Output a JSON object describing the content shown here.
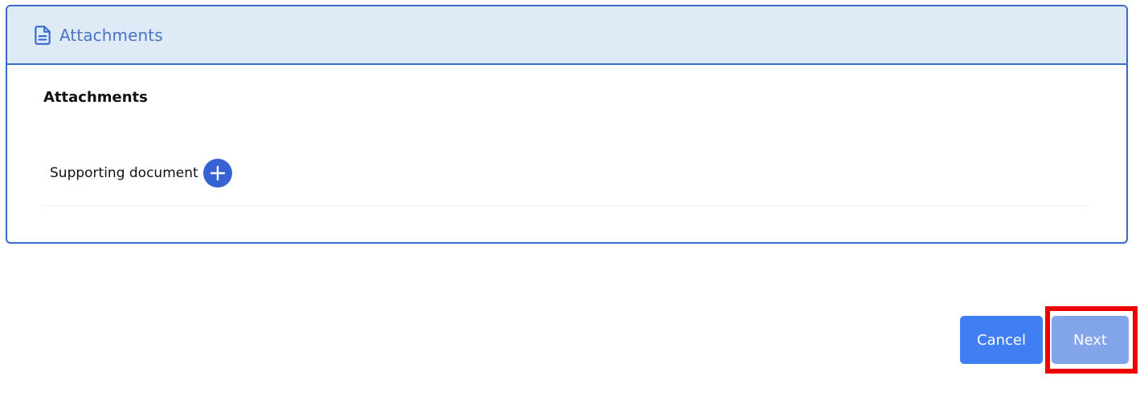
{
  "panel": {
    "header_title": "Attachments",
    "header_icon": "document-icon",
    "section_title": "Attachments",
    "fields": [
      {
        "label": "Supporting document",
        "action_icon": "plus-icon"
      }
    ]
  },
  "footer": {
    "cancel_label": "Cancel",
    "next_label": "Next"
  },
  "colors": {
    "header_bg": "#dfeaf7",
    "border": "#3a6bc9",
    "primary": "#3f7ff2",
    "primary_disabled": "#82a4e9",
    "highlight": "#ee0000"
  }
}
